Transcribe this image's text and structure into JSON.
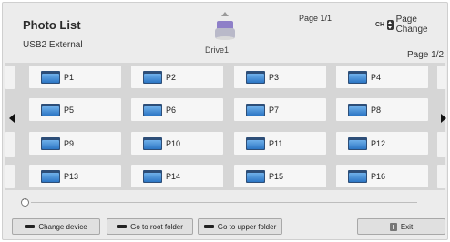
{
  "header": {
    "title": "Photo List",
    "subtitle": "USB2 External",
    "drive_label": "Drive1",
    "page_top": "Page 1/1",
    "ch_label": "CH",
    "page_change_label": "Page Change",
    "page_right": "Page 1/2"
  },
  "folders": [
    {
      "label": "P1"
    },
    {
      "label": "P2"
    },
    {
      "label": "P3"
    },
    {
      "label": "P4"
    },
    {
      "label": "P5"
    },
    {
      "label": "P6"
    },
    {
      "label": "P7"
    },
    {
      "label": "P8"
    },
    {
      "label": "P9"
    },
    {
      "label": "P10"
    },
    {
      "label": "P11"
    },
    {
      "label": "P12"
    },
    {
      "label": "P13"
    },
    {
      "label": "P14"
    },
    {
      "label": "P15"
    },
    {
      "label": "P16"
    }
  ],
  "buttons": {
    "change_device": "Change device",
    "go_root": "Go to root folder",
    "go_upper": "Go to upper folder",
    "exit": "Exit"
  }
}
